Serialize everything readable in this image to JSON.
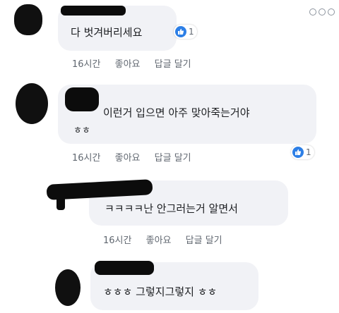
{
  "comments": [
    {
      "text": "다 벗겨버리세요",
      "reactions": "1",
      "time": "16시간",
      "like": "좋아요",
      "reply": "답글 달기"
    },
    {
      "text_line1": "이런거 입으면 아주 맞아죽는거야",
      "text_line2": "ㅎㅎ",
      "reactions": "1",
      "time": "16시간",
      "like": "좋아요",
      "reply": "답글 달기"
    },
    {
      "text": "ㅋㅋㅋㅋ난 안그러는거 알면서",
      "time": "16시간",
      "like": "좋아요",
      "reply": "답글 달기"
    },
    {
      "text": "ㅎㅎㅎ 그렇지그렇지 ㅎㅎ"
    }
  ],
  "icons": {
    "more": "more-options-icon",
    "like": "thumbs-up-icon"
  },
  "colors": {
    "like_blue": "#2d7fe6",
    "bubble": "#f1f2f6",
    "meta_text": "#606770"
  }
}
